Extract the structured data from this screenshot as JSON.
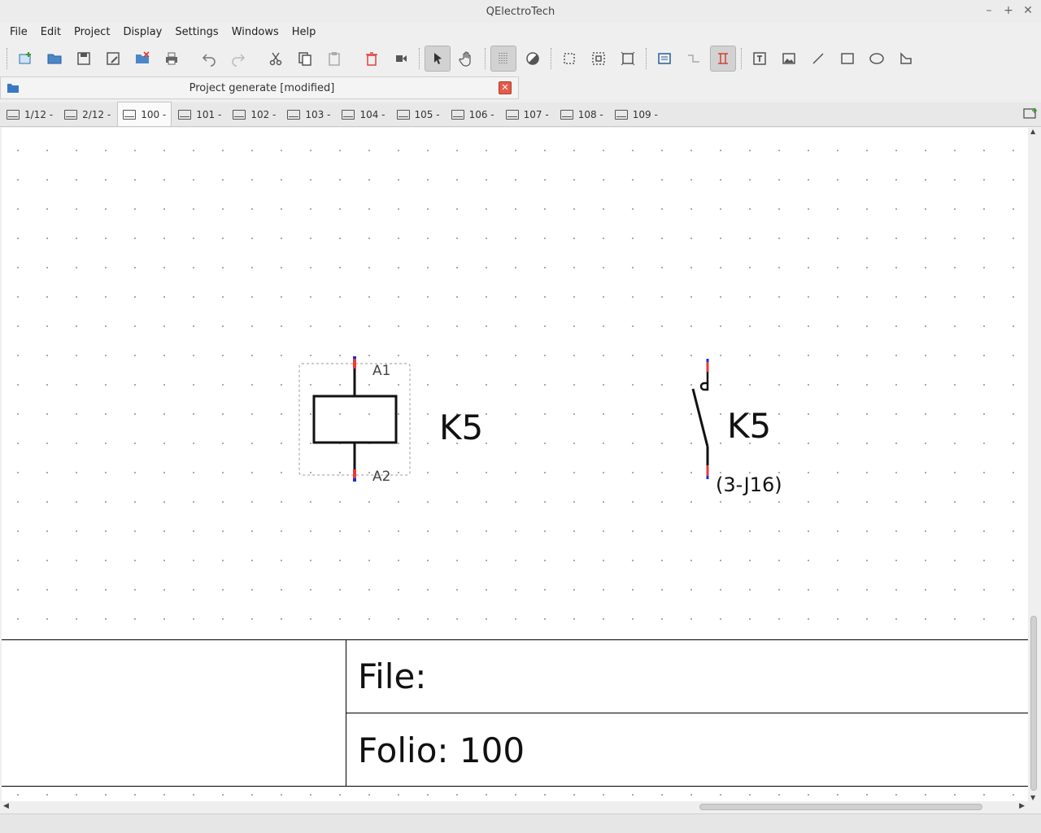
{
  "app": {
    "title": "QElectroTech"
  },
  "window_controls": [
    "–",
    "+",
    "✕"
  ],
  "menu": [
    "File",
    "Edit",
    "Project",
    "Display",
    "Settings",
    "Windows",
    "Help"
  ],
  "toolbar": {
    "icons": [
      "new-project-icon",
      "open-icon",
      "save-icon",
      "save-as-icon",
      "close-project-icon",
      "print-icon",
      "undo-icon",
      "redo-icon",
      "cut-icon",
      "copy-icon",
      "paste-icon",
      "delete-icon",
      "rotate-icon",
      "select-mode-icon",
      "pan-mode-icon",
      "grid-icon",
      "color-icon",
      "zoom-fit-icon",
      "zoom-content-icon",
      "zoom-reset-icon",
      "edit-title-block-icon",
      "conductor-icon",
      "autoconnect-icon",
      "add-text-icon",
      "add-image-icon",
      "add-line-icon",
      "add-rectangle-icon",
      "add-ellipse-icon",
      "add-polyline-icon"
    ]
  },
  "project": {
    "title": "Project generate [modified]",
    "close": "✕"
  },
  "tabs": [
    "1/12 -",
    "2/12 -",
    "100 -",
    "101 -",
    "102 -",
    "103 -",
    "104 -",
    "105 -",
    "106 -",
    "107 -",
    "108 -",
    "109 -"
  ],
  "selected_tab": "100 -",
  "diagram": {
    "coil": {
      "terminal_top": "A1",
      "terminal_bottom": "A2",
      "label": "K5"
    },
    "contact": {
      "label": "K5",
      "reference": "(3-J16)"
    }
  },
  "title_block": {
    "file": "File:",
    "folio": "Folio: 100"
  },
  "colors": {
    "accent": "#e53b3b",
    "terminal_blue": "#1f2bd6"
  }
}
